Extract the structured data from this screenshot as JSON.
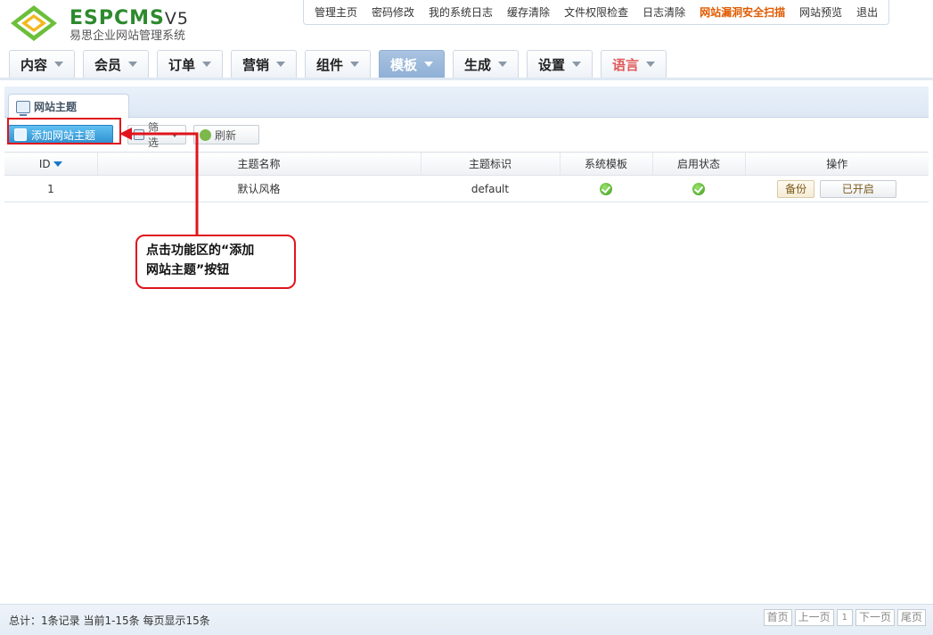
{
  "logo": {
    "brand": "ESPCMS",
    "version": "V5",
    "subtitle": "易思企业网站管理系统"
  },
  "topnav": {
    "items": [
      "管理主页",
      "密码修改",
      "我的系统日志",
      "缓存清除",
      "文件权限检查",
      "日志清除",
      "网站漏洞安全扫描",
      "网站预览",
      "退出"
    ],
    "alert_index": 6,
    "alert_color": "#e05a00"
  },
  "mainnav": {
    "tabs": [
      "内容",
      "会员",
      "订单",
      "营销",
      "组件",
      "模板",
      "生成",
      "设置",
      "语言"
    ],
    "active": "模板"
  },
  "panel": {
    "tab_label": "网站主题"
  },
  "toolbar": {
    "add_label": "添加网站主题",
    "filter_label": "筛选",
    "refresh_label": "刷新"
  },
  "table": {
    "headers": [
      "ID",
      "主题名称",
      "主题标识",
      "系统模板",
      "启用状态",
      "操作"
    ],
    "rows": [
      {
        "id": "1",
        "name": "默认风格",
        "key": "default",
        "system": true,
        "enabled": true,
        "backup": "备份",
        "status_btn": "已开启"
      }
    ]
  },
  "callout": {
    "line1": "点击功能区的“添加",
    "line2": "网站主题”按钮"
  },
  "footer": {
    "summary": "总计：1条记录 当前1-15条 每页显示15条",
    "pager": {
      "first": "首页",
      "prev": "上一页",
      "current": "1",
      "next": "下一页",
      "last": "尾页"
    }
  },
  "colors": {
    "highlight_red": "#e0141c",
    "active_tab": "#8fb0d6",
    "brand_green": "#2d8a2d"
  }
}
